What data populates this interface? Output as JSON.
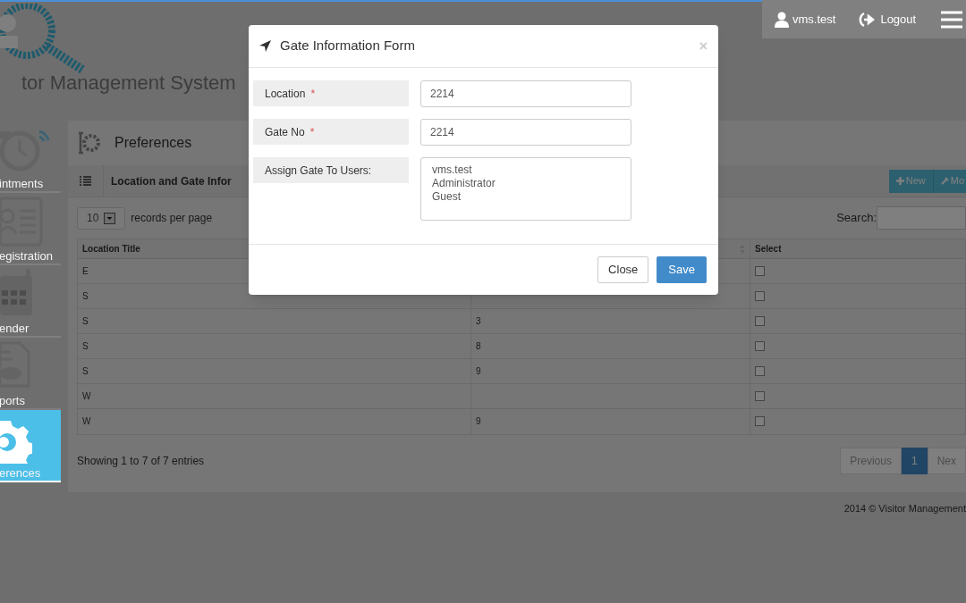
{
  "header": {
    "logo_text": "tor Management System",
    "user": "vms.test",
    "logout": "Logout"
  },
  "sidebar": {
    "items": [
      {
        "label": "intments",
        "kind": "clock",
        "selected": false
      },
      {
        "label": "egistration",
        "kind": "card",
        "selected": false
      },
      {
        "label": "ender",
        "kind": "calendar",
        "selected": false
      },
      {
        "label": "ports",
        "kind": "report",
        "selected": false
      },
      {
        "label": "erences",
        "kind": "gear",
        "selected": true
      }
    ]
  },
  "page_title": "Preferences",
  "panel": {
    "title": "Location and Gate Infor",
    "buttons": [
      "New",
      "Mo"
    ]
  },
  "table_controls": {
    "page_size": "10",
    "page_size_label": "records per page",
    "search_label": "Search:"
  },
  "table": {
    "columns": [
      {
        "label": "Location Title",
        "sortable": false
      },
      {
        "sortable": true
      },
      {
        "label": "Select",
        "sortable": false
      }
    ],
    "rows": [
      {
        "location_title": "E",
        "checked": false
      },
      {
        "location_title": "S",
        "checked": false
      },
      {
        "location_title": "S",
        "column_2": "3",
        "checked": false
      },
      {
        "location_title": "S",
        "column_2": "8",
        "checked": false
      },
      {
        "location_title": "S",
        "column_2": "9",
        "checked": false
      },
      {
        "location_title": "W",
        "checked": false
      },
      {
        "location_title": "W",
        "column_2": "9",
        "checked": false
      }
    ]
  },
  "table_info": "Showing 1 to 7 of 7 entries",
  "pagination": [
    {
      "label": "Previous",
      "selected": false
    },
    {
      "label": "1",
      "selected": true
    },
    {
      "label": "Nex",
      "selected": false
    }
  ],
  "footer": "2014 © Visitor Management",
  "modal": {
    "title": "Gate Information Form",
    "close": "×",
    "fields": [
      {
        "label": "Location",
        "required_mark": "*",
        "kind": "input",
        "value": "2214"
      },
      {
        "label": "Gate No",
        "required_mark": "*",
        "kind": "input",
        "value": "2214"
      },
      {
        "label": "Assign Gate To Users:",
        "kind": "list",
        "options": [
          "vms.test",
          "Administrator",
          "Guest"
        ]
      }
    ],
    "buttons": [
      {
        "label": "Close",
        "kind": "default"
      },
      {
        "label": "Save",
        "kind": "primary"
      }
    ]
  }
}
